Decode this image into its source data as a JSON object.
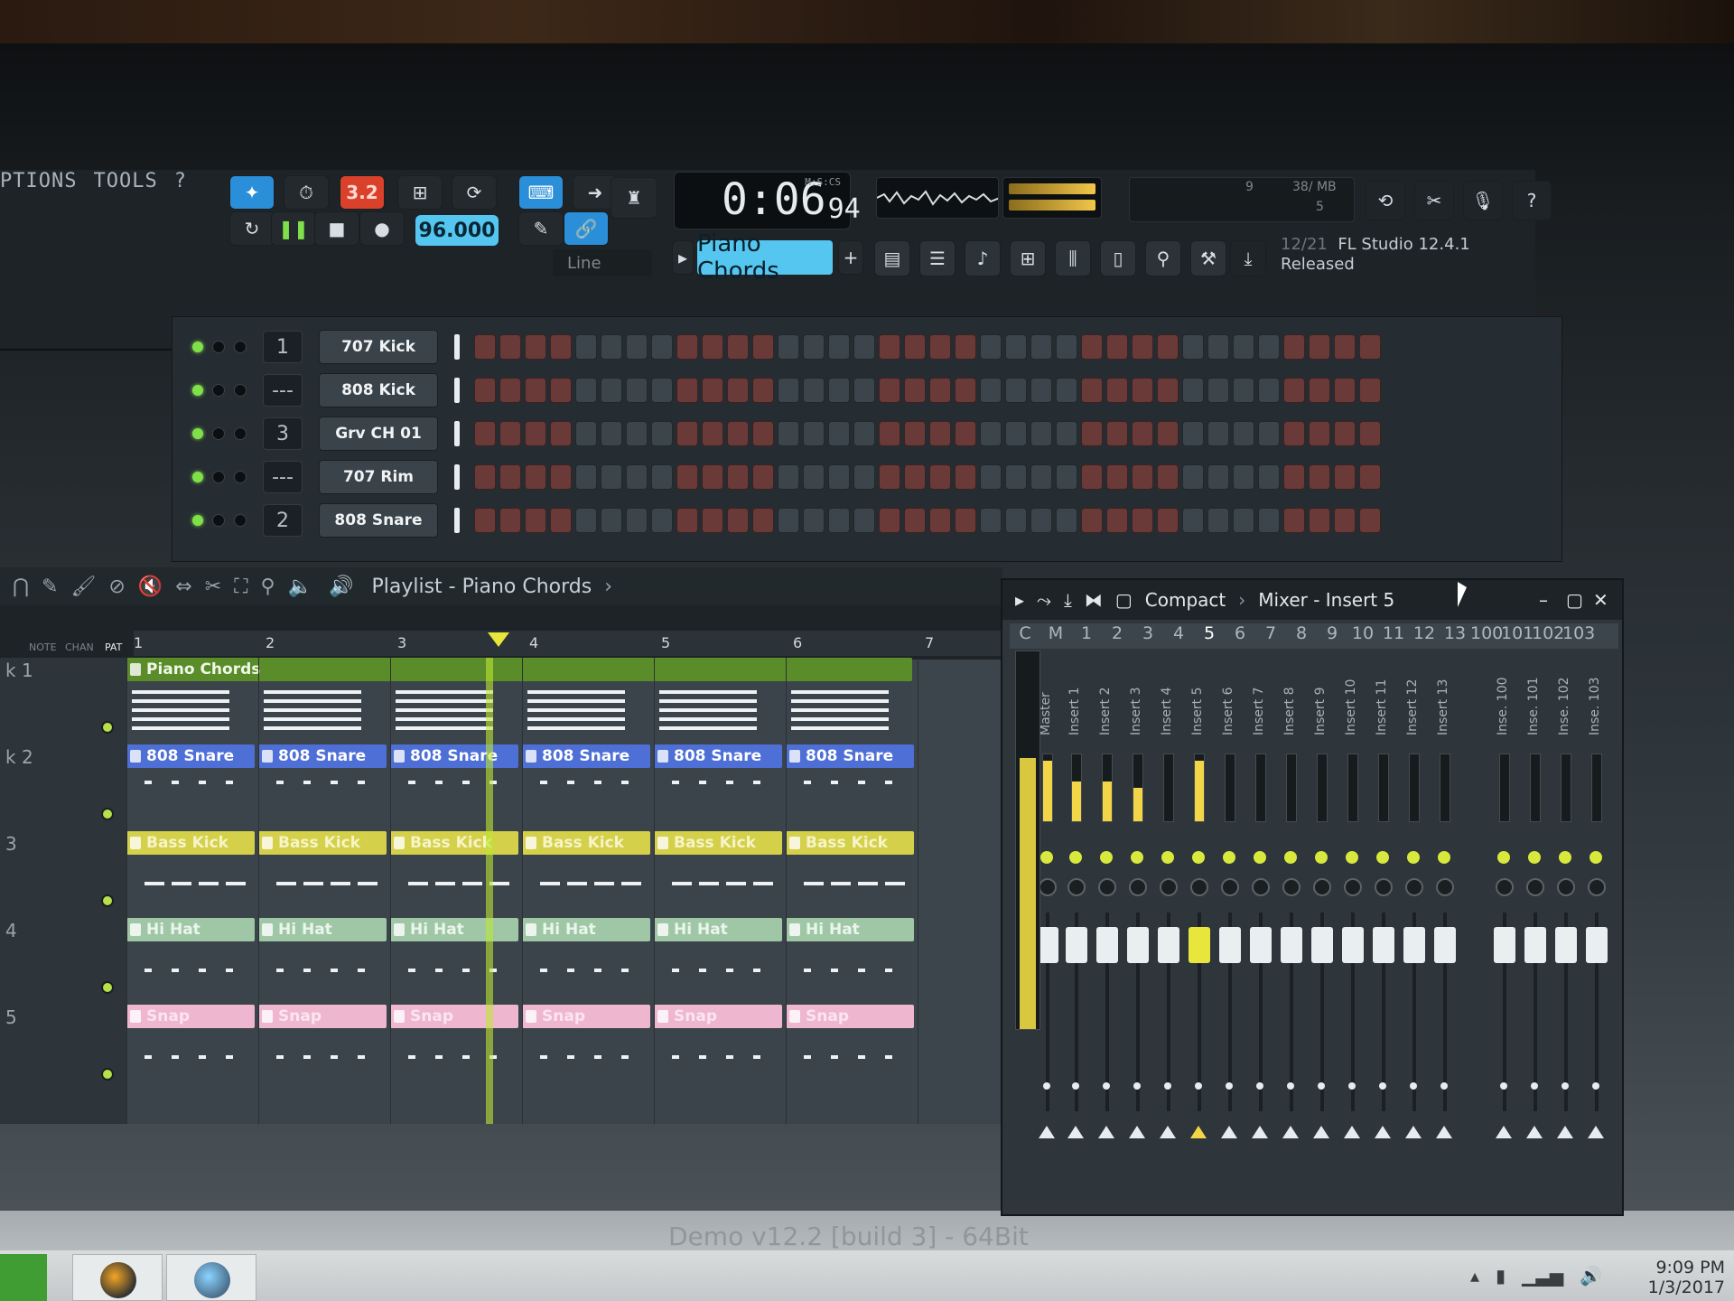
{
  "menu": {
    "options": "PTIONS",
    "tools": "TOOLS",
    "help": "?"
  },
  "transport": {
    "song_mode": "3.2",
    "tempo": "96.000",
    "snap": "Line",
    "time_main": "0:06",
    "time_frac": "94",
    "time_unit": "M:S:CS",
    "pattern": "Piano Chords",
    "add_pattern": "+"
  },
  "cpu": {
    "a": "9",
    "b": "38/ MB",
    "c": "5"
  },
  "info": {
    "date": "12/21",
    "title": "FL Studio 12.4.1",
    "status": "Released"
  },
  "rack": [
    {
      "num": "1",
      "name": "707 Kick"
    },
    {
      "num": "---",
      "name": "808 Kick"
    },
    {
      "num": "3",
      "name": "Grv CH 01"
    },
    {
      "num": "---",
      "name": "707 Rim"
    },
    {
      "num": "2",
      "name": "808 Snare"
    }
  ],
  "playlist": {
    "title": "Playlist - Piano Chords",
    "labels": {
      "note": "NOTE",
      "chan": "CHAN",
      "pat": "PAT"
    },
    "bars": [
      "1",
      "2",
      "3",
      "4",
      "5",
      "6",
      "7"
    ],
    "tracks": [
      "k 1",
      "k 2",
      "3",
      "4",
      "5"
    ],
    "clips": {
      "piano": "Piano Chords",
      "snare": "808 Snare",
      "bass": "Bass Kick",
      "hihat": "Hi Hat",
      "snap": "Snap"
    }
  },
  "mixer": {
    "mode": "Compact",
    "title": "Mixer - Insert 5",
    "header": [
      "C",
      "M",
      "1",
      "2",
      "3",
      "4",
      "5",
      "6",
      "7",
      "8",
      "9",
      "10",
      "11",
      "12",
      "13",
      "100",
      "101",
      "102",
      "103"
    ],
    "strips": [
      "Master",
      "Insert 1",
      "Insert 2",
      "Insert 3",
      "Insert 4",
      "Insert 5",
      "Insert 6",
      "Insert 7",
      "Insert 8",
      "Insert 9",
      "Insert 10",
      "Insert 11",
      "Insert 12",
      "Insert 13",
      "Inse. 100",
      "Inse. 101",
      "Inse. 102",
      "Inse. 103"
    ],
    "levels": [
      0.9,
      0.6,
      0.6,
      0.5,
      0,
      0.9,
      0,
      0,
      0,
      0,
      0,
      0,
      0,
      0,
      0,
      0,
      0,
      0
    ]
  },
  "watermark": "Demo v12.2 [build 3] - 64Bit",
  "taskbar": {
    "time": "9:09 PM",
    "date": "1/3/2017"
  },
  "colors": {
    "accent_blue": "#55c6ef",
    "song_red": "#d9412b",
    "led_green": "#7fe04a",
    "playhead_yellow": "#e8e63c"
  }
}
